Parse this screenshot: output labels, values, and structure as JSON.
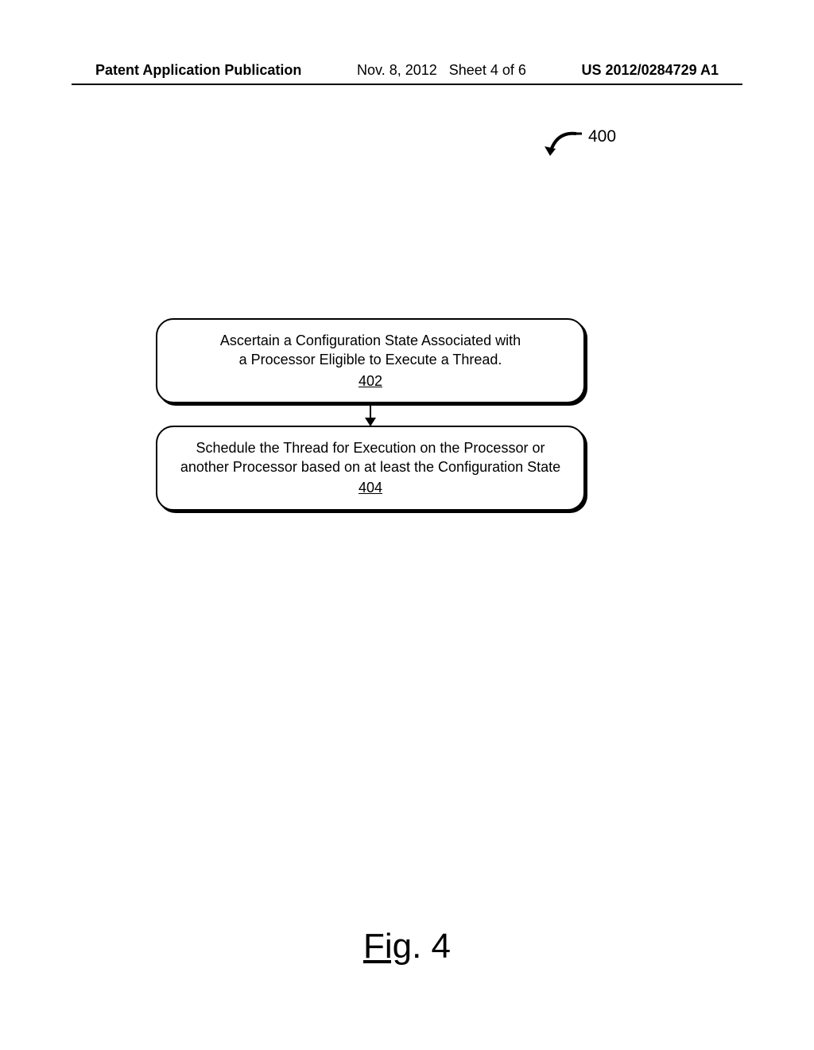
{
  "header": {
    "left": "Patent Application Publication",
    "center_date": "Nov. 8, 2012",
    "center_sheet": "Sheet 4 of 6",
    "right": "US 2012/0284729 A1"
  },
  "figure_reference": {
    "label": "400"
  },
  "flowchart": {
    "boxes": [
      {
        "text_line1": "Ascertain a Configuration State Associated with",
        "text_line2": "a Processor Eligible to Execute a Thread.",
        "ref": "402"
      },
      {
        "text_line1": "Schedule the Thread for Execution on the Processor or",
        "text_line2": "another Processor based on at least the Configuration State",
        "ref": "404"
      }
    ]
  },
  "caption": {
    "prefix": "Fig",
    "suffix": ". 4"
  }
}
